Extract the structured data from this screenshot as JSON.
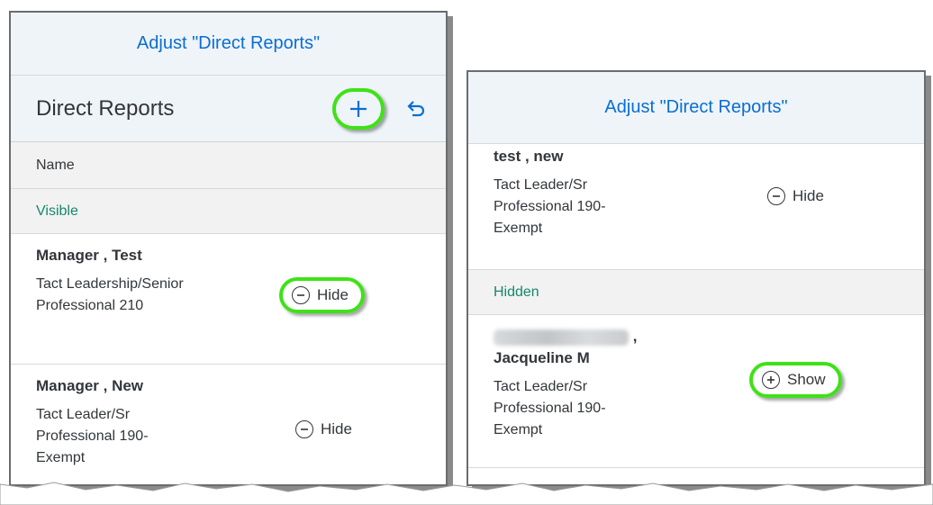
{
  "left_panel": {
    "dialog_title": "Adjust \"Direct Reports\"",
    "list_title": "Direct Reports",
    "add_icon": "plus-icon",
    "undo_icon": "undo-icon",
    "column_header": "Name",
    "group_visible": "Visible",
    "rows": [
      {
        "name": "Manager , Test",
        "desc": "Tact Leadership/Senior Professional 210",
        "action": "Hide"
      },
      {
        "name": "Manager , New",
        "desc": "Tact Leader/Sr Professional 190-Exempt",
        "action": "Hide"
      }
    ]
  },
  "right_panel": {
    "dialog_title": "Adjust \"Direct Reports\"",
    "rows_visible": [
      {
        "name": "test , new",
        "desc": "Tact Leader/Sr Professional 190-Exempt",
        "action": "Hide"
      }
    ],
    "group_hidden": "Hidden",
    "rows_hidden": [
      {
        "name_suffix": ",",
        "name": "Jacqueline M",
        "desc": "Tact Leader/Sr Professional 190-Exempt",
        "action": "Show"
      }
    ]
  },
  "colors": {
    "accent": "#0a6ed1",
    "group_text": "#16876c",
    "highlight": "#3ee216"
  }
}
